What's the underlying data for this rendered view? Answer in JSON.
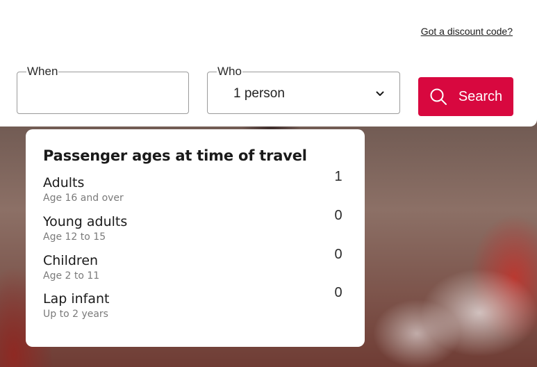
{
  "header": {
    "discount_link": "Got a discount code?"
  },
  "search": {
    "when_label": "When",
    "when_value": "",
    "who_label": "Who",
    "who_value": "1 person",
    "search_button": "Search"
  },
  "passengers": {
    "title": "Passenger ages at time of travel",
    "rows": [
      {
        "name": "Adults",
        "sub": "Age 16 and over",
        "count": "1"
      },
      {
        "name": "Young adults",
        "sub": "Age 12 to 15",
        "count": "0"
      },
      {
        "name": "Children",
        "sub": "Age 2 to 11",
        "count": "0"
      },
      {
        "name": "Lap infant",
        "sub": "Up to 2 years",
        "count": "0"
      }
    ]
  },
  "colors": {
    "accent": "#d8083f"
  }
}
